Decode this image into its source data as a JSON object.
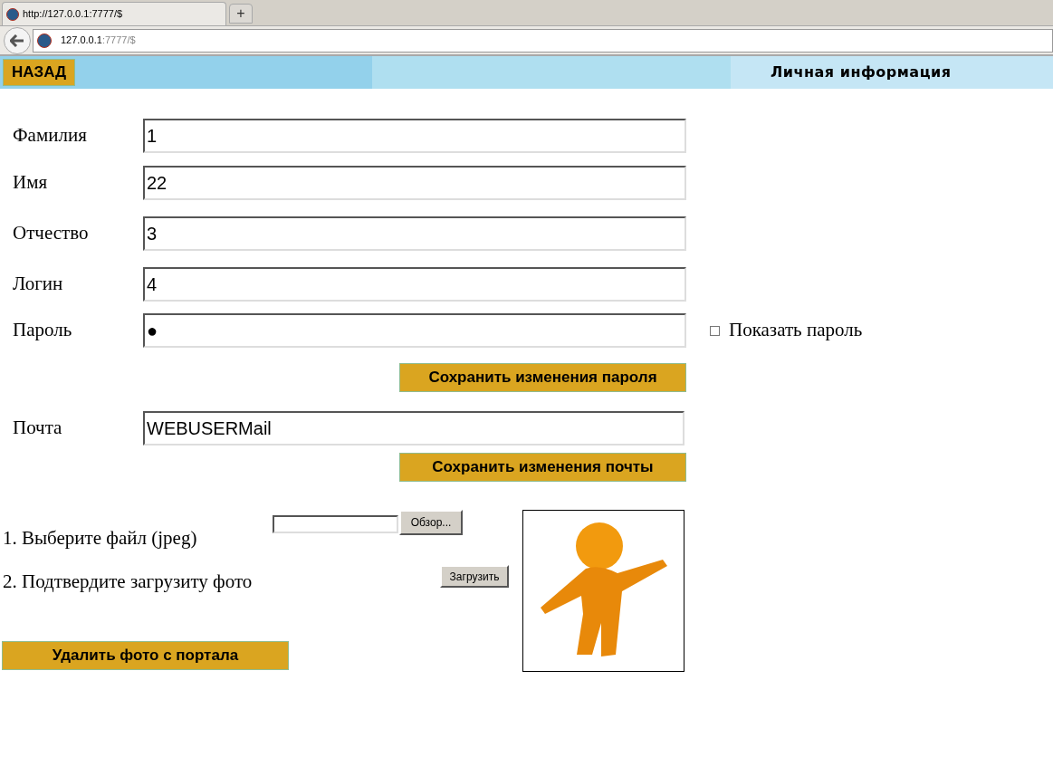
{
  "browser": {
    "tab_title": "http://127.0.0.1:7777/$",
    "new_tab": "+",
    "address_host": "127.0.0.1",
    "address_path": ":7777/$"
  },
  "header": {
    "back": "НАЗАД",
    "title": "Личная информация"
  },
  "fields": [
    {
      "label": "Фамилия",
      "value": "1"
    },
    {
      "label": "Имя",
      "value": "22"
    },
    {
      "label": "Отчество",
      "value": "3"
    },
    {
      "label": "Логин",
      "value": "4"
    },
    {
      "label": "Пароль",
      "value": "●"
    }
  ],
  "show_password": {
    "label": "Показать пароль",
    "checked": false
  },
  "save_password": "Сохранить изменения пароля",
  "mail": {
    "label": "Почта",
    "value": "WEBUSERMail"
  },
  "save_mail": "Сохранить изменения почты",
  "upload": {
    "step1": "1. Выберите файл (jpeg)",
    "browse": "Обзор...",
    "step2": "2. Подтвердите загрузиту фото",
    "upload": "Загрузить"
  },
  "delete_photo": "Удалить фото с портала"
}
